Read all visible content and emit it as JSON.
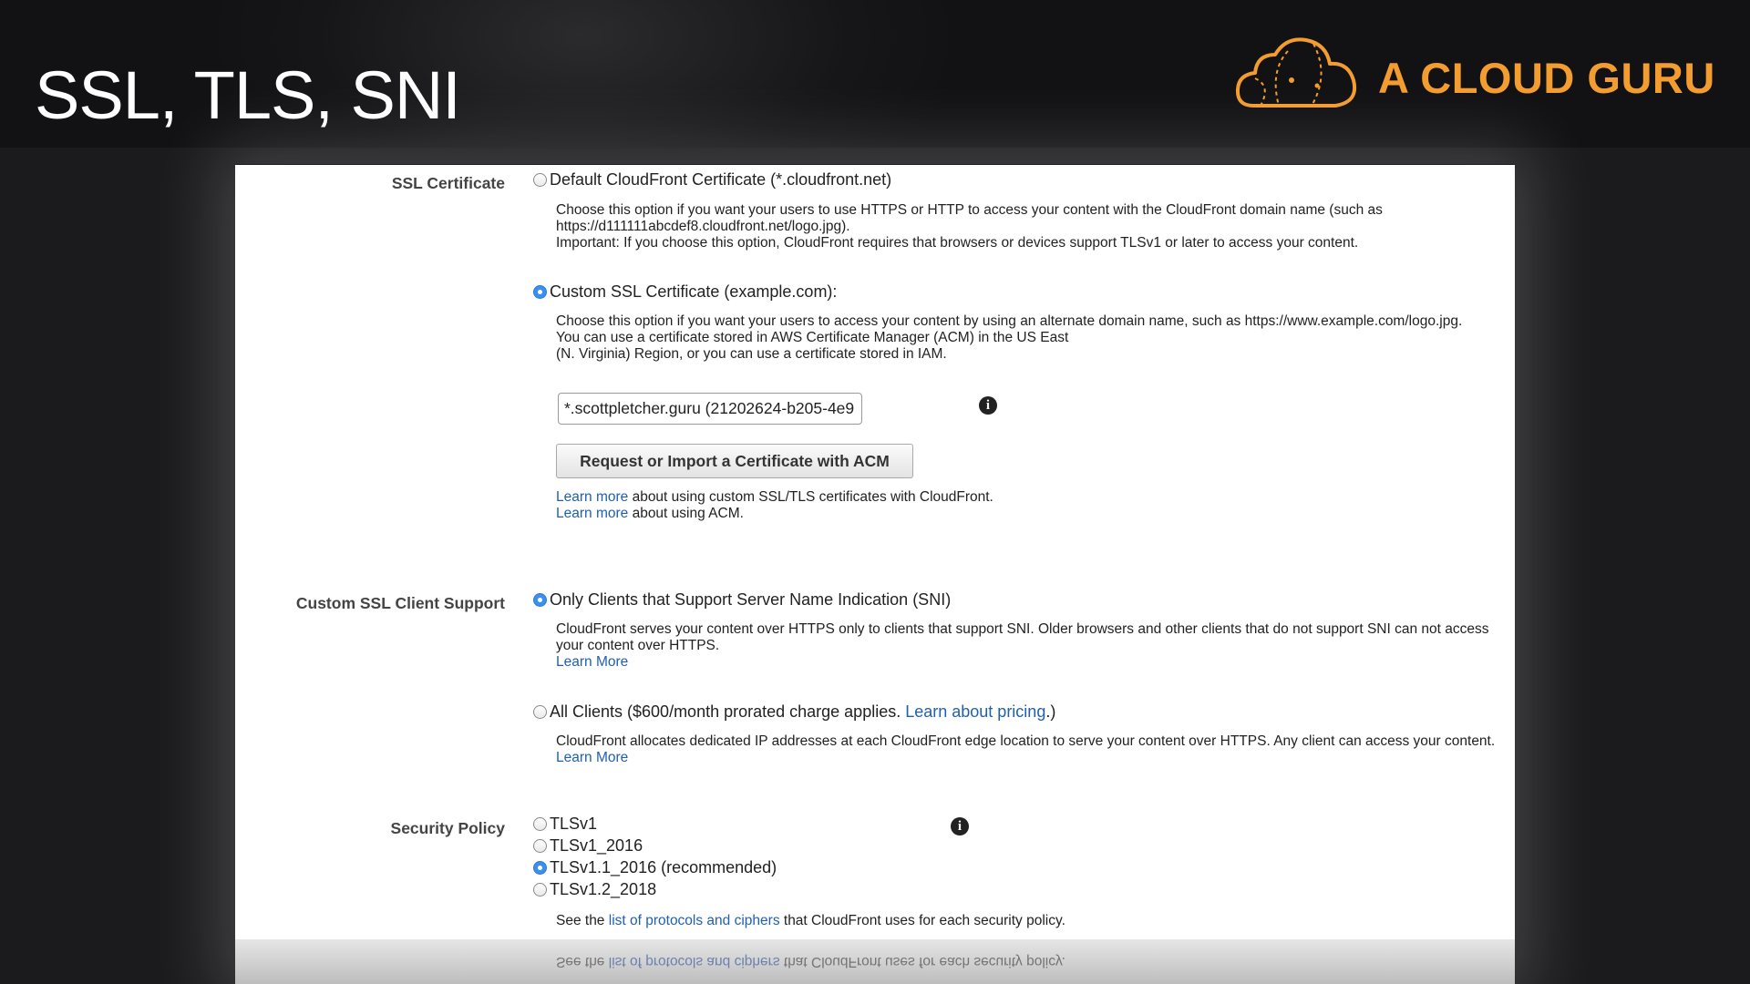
{
  "slide": {
    "title": "SSL, TLS, SNI"
  },
  "brand": {
    "name": "A CLOUD GURU",
    "color": "#f39c2f"
  },
  "ssl_certificate": {
    "label": "SSL Certificate",
    "default_option": {
      "label": "Default CloudFront Certificate (*.cloudfront.net)",
      "selected": false,
      "desc_lines": [
        "Choose this option if you want your users to use HTTPS or HTTP to access your content with the CloudFront domain name (such as",
        "https://d111111abcdef8.cloudfront.net/logo.jpg).",
        "Important: If you choose this option, CloudFront requires that browsers or devices support TLSv1 or later to access your content."
      ]
    },
    "custom_option": {
      "label": "Custom SSL Certificate (example.com):",
      "selected": true,
      "desc_lines": [
        "Choose this option if you want your users to access your content by using an alternate domain name, such as https://www.example.com/logo.jpg.",
        "You can use a certificate stored in AWS Certificate Manager (ACM) in the US East",
        "(N. Virginia) Region, or you can use a certificate stored in IAM."
      ]
    },
    "certificate_value": "*.scottpletcher.guru (21202624-b205-4e9",
    "info_icon": "info-icon",
    "acm_button": "Request or Import a Certificate with ACM",
    "learn_more_1_link": "Learn more",
    "learn_more_1_text": " about using custom SSL/TLS certificates with CloudFront.",
    "learn_more_2_link": "Learn more",
    "learn_more_2_text": " about using ACM."
  },
  "client_support": {
    "label": "Custom SSL Client Support",
    "sni_option": {
      "label": "Only Clients that Support Server Name Indication (SNI)",
      "selected": true,
      "desc_lines": [
        "CloudFront serves your content over HTTPS only to clients that support SNI. Older browsers and other clients that do not support SNI can not access",
        "your content over HTTPS."
      ],
      "learn_more": "Learn More"
    },
    "all_option": {
      "label_prefix": "All Clients ($600/month prorated charge applies. ",
      "pricing_link": "Learn about pricing",
      "label_suffix": ".)",
      "selected": false,
      "desc": "CloudFront allocates dedicated IP addresses at each CloudFront edge location to serve your content over HTTPS. Any client can access your content.",
      "learn_more": "Learn More"
    }
  },
  "security_policy": {
    "label": "Security Policy",
    "options": [
      {
        "label": "TLSv1",
        "selected": false
      },
      {
        "label": "TLSv1_2016",
        "selected": false
      },
      {
        "label": "TLSv1.1_2016 (recommended)",
        "selected": true
      },
      {
        "label": "TLSv1.2_2018",
        "selected": false
      }
    ],
    "note_prefix": "See the ",
    "note_link": "list of protocols and ciphers",
    "note_suffix": " that CloudFront uses for each security policy.",
    "info_icon": "info-icon"
  }
}
